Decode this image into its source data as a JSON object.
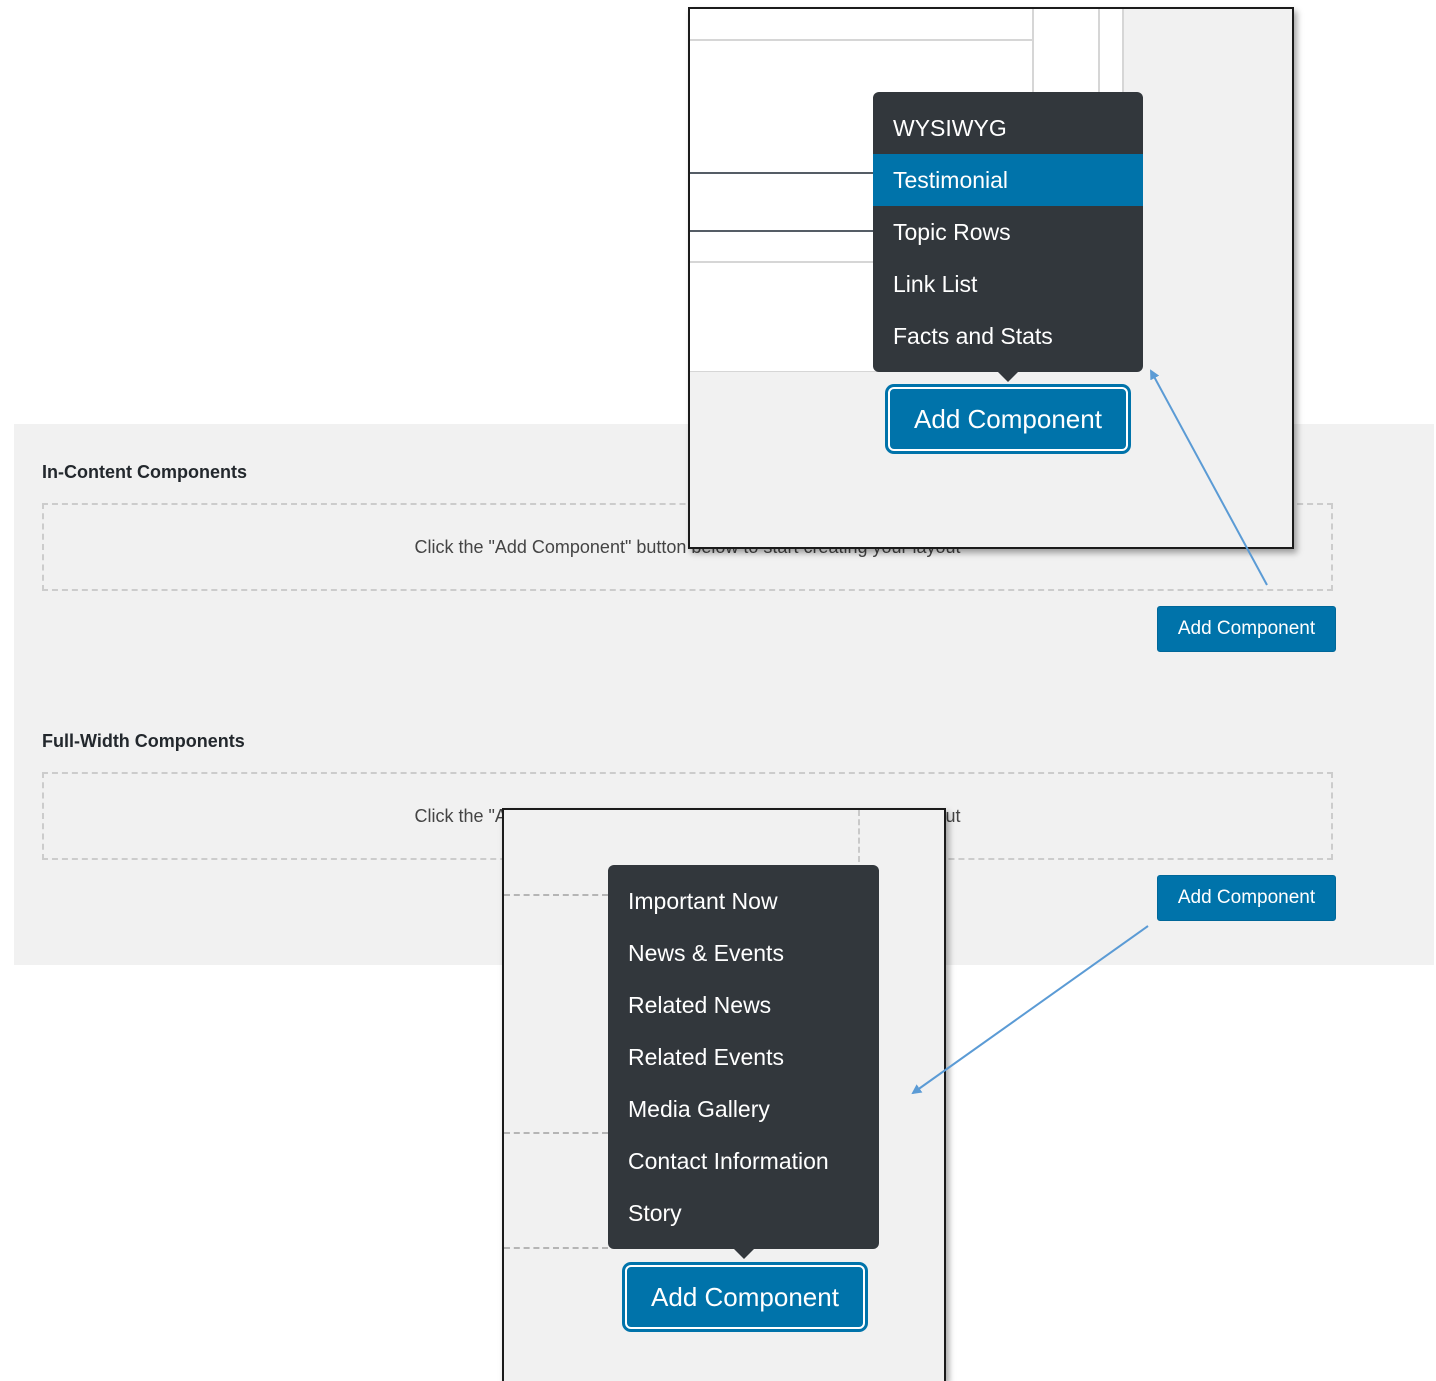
{
  "in_content": {
    "title": "In-Content Components",
    "placeholder": "Click the \"Add Component\" button below to start creating your layout",
    "button": "Add Component"
  },
  "full_width": {
    "title": "Full-Width Components",
    "placeholder": "Click the \"Add Component\" button below to start creating your layout",
    "button": "Add Component"
  },
  "zoom_in_content": {
    "menu": [
      "WYSIWYG",
      "Testimonial",
      "Topic Rows",
      "Link List",
      "Facts and Stats"
    ],
    "highlighted": "Testimonial",
    "button": "Add Component"
  },
  "zoom_full_width": {
    "menu": [
      "Important Now",
      "News & Events",
      "Related News",
      "Related Events",
      "Media Gallery",
      "Contact Information",
      "Story"
    ],
    "button": "Add Component"
  },
  "colors": {
    "accent": "#0073aa",
    "menu_bg": "#32373c",
    "panel_bg": "#f1f1f1",
    "arrow": "#5b9bd5"
  }
}
